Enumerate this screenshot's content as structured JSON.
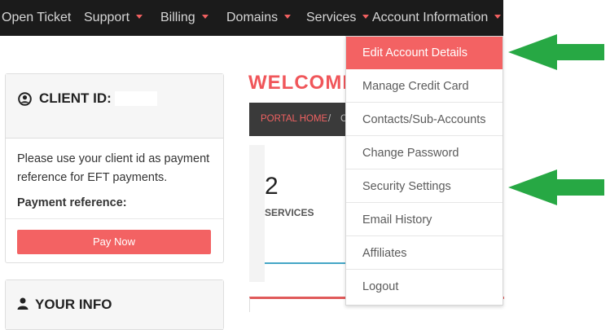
{
  "nav": {
    "items": [
      {
        "label": "Open Ticket",
        "caret": false
      },
      {
        "label": "Support",
        "caret": true
      },
      {
        "label": "Billing",
        "caret": true
      },
      {
        "label": "Domains",
        "caret": true
      },
      {
        "label": "Services",
        "caret": true
      },
      {
        "label": "Account Information",
        "caret": true
      }
    ]
  },
  "client_card": {
    "title": "CLIENT ID:",
    "note": "Please use your client id as payment reference for EFT payments.",
    "payment_reference_label": "Payment reference:",
    "pay_button": "Pay Now"
  },
  "info_card": {
    "title": "YOUR INFO"
  },
  "main": {
    "welcome": "WELCOME",
    "breadcrumb": {
      "home": "PORTAL HOME",
      "separator": "/",
      "current": "C"
    },
    "stat": {
      "value": "2",
      "label": "SERVICES"
    }
  },
  "dropdown": {
    "items": [
      "Edit Account Details",
      "Manage Credit Card",
      "Contacts/Sub-Accounts",
      "Change Password",
      "Security Settings",
      "Email History",
      "Affiliates",
      "Logout"
    ],
    "active_index": 0
  },
  "colors": {
    "accent": "#f36263",
    "nav_bg": "#1b1b1b",
    "arrow": "#27a844"
  }
}
